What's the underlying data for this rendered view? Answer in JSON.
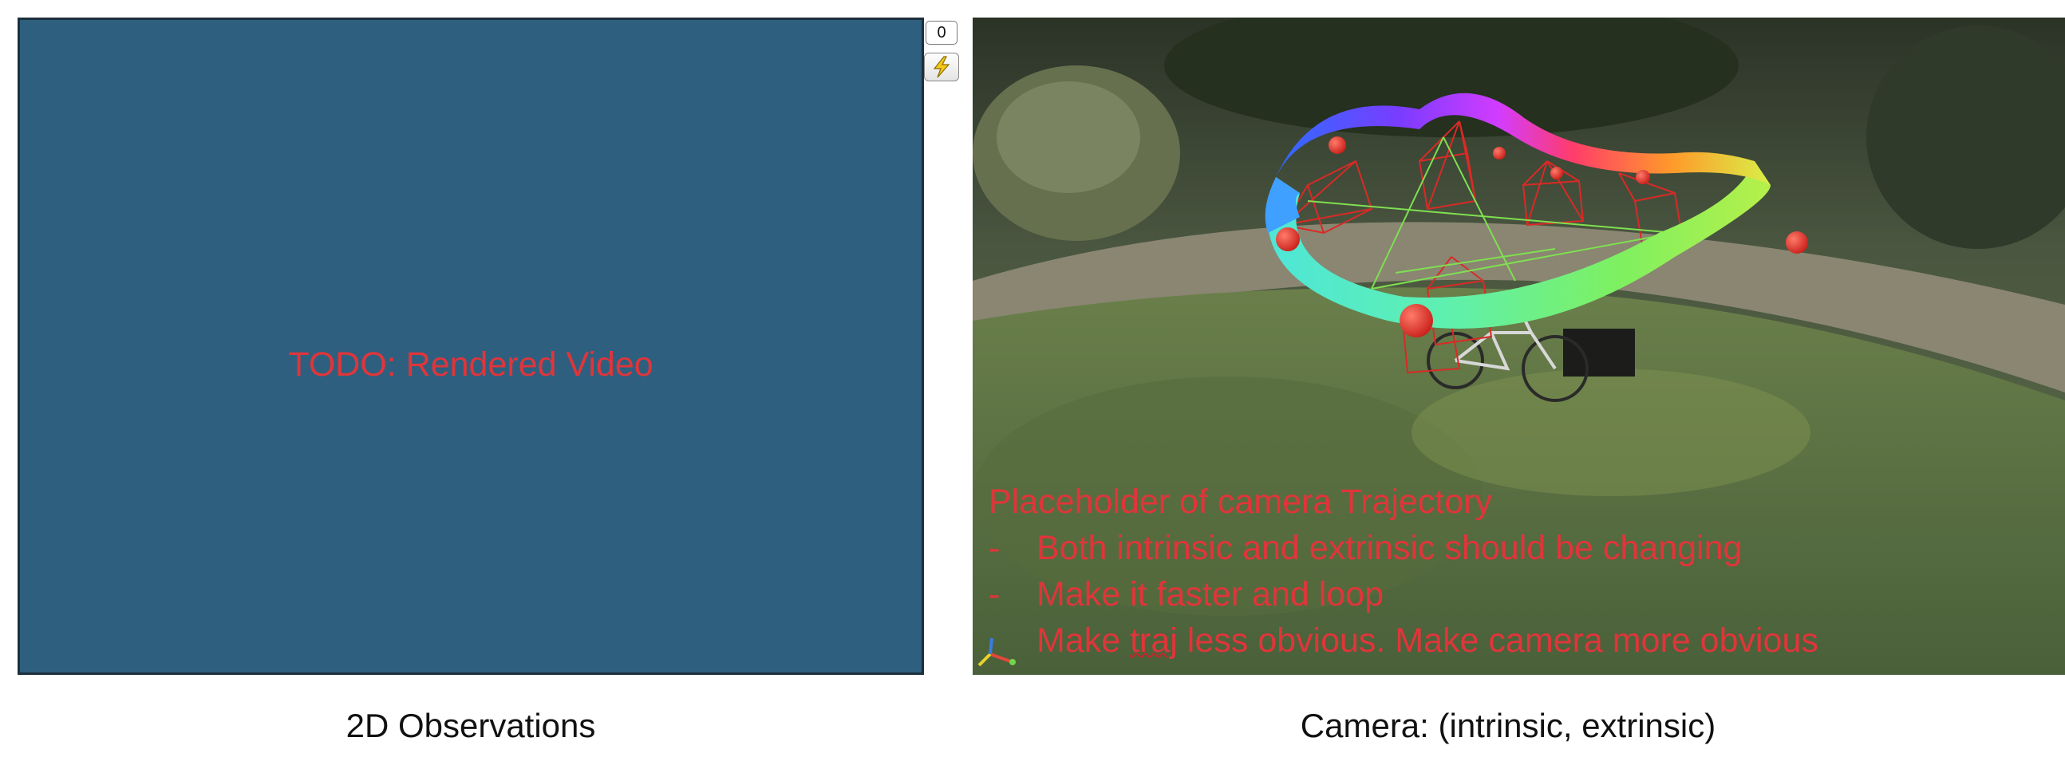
{
  "left_panel": {
    "placeholder_text": "TODO: Rendered Video",
    "caption": "2D Observations"
  },
  "controls": {
    "counter_value": "0",
    "action_icon": "lightning-bolt-icon"
  },
  "right_panel": {
    "caption": "Camera: (intrinsic, extrinsic)",
    "notes": {
      "title": "Placeholder of camera Trajectory",
      "items": [
        {
          "bullet": "-",
          "text": "Both intrinsic and extrinsic should be changing"
        },
        {
          "bullet": "-",
          "text": "Make it faster and loop"
        }
      ],
      "last_item": {
        "pre": "Make ",
        "underlined": "traj",
        "post": " less obvious. Make camera more obvious"
      }
    },
    "axes_icon": "xyz-axes-gizmo-icon"
  },
  "colors": {
    "placeholder_bg": "#2e5f7f",
    "note_text": "#e0353a",
    "frustum": "#d92a26"
  }
}
